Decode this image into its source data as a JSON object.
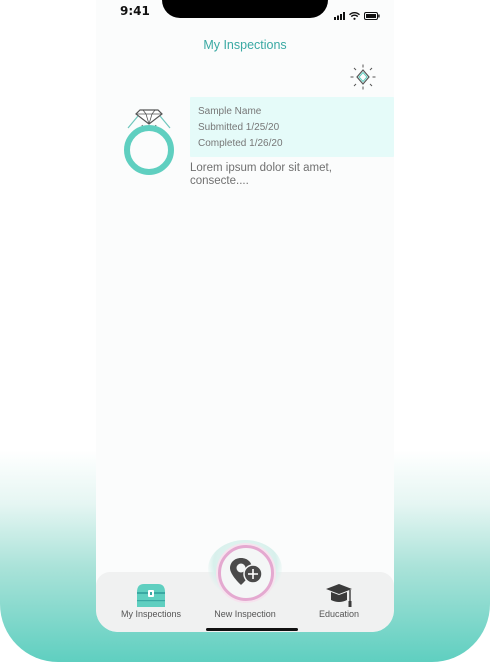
{
  "status_bar": {
    "time": "9:41"
  },
  "header": {
    "title": "My Inspections"
  },
  "inspection": {
    "name": "Sample Name",
    "submitted": "Submitted 1/25/20",
    "completed": "Completed 1/26/20",
    "description": "Lorem ipsum dolor sit amet, consecte...."
  },
  "bottom_nav": {
    "items": [
      {
        "label": "My Inspections",
        "icon": "treasure-chest-icon"
      },
      {
        "label": "New Inspection",
        "icon": "location-pin-plus-icon"
      },
      {
        "label": "Education",
        "icon": "graduation-cap-icon"
      }
    ]
  },
  "colors": {
    "accent": "#3aa9a3",
    "ring": "#5fcfc0",
    "info_bg": "#e5fbf9",
    "fab_border": "#e4a9d0",
    "bottom_gradient": "#5fcfc0"
  }
}
